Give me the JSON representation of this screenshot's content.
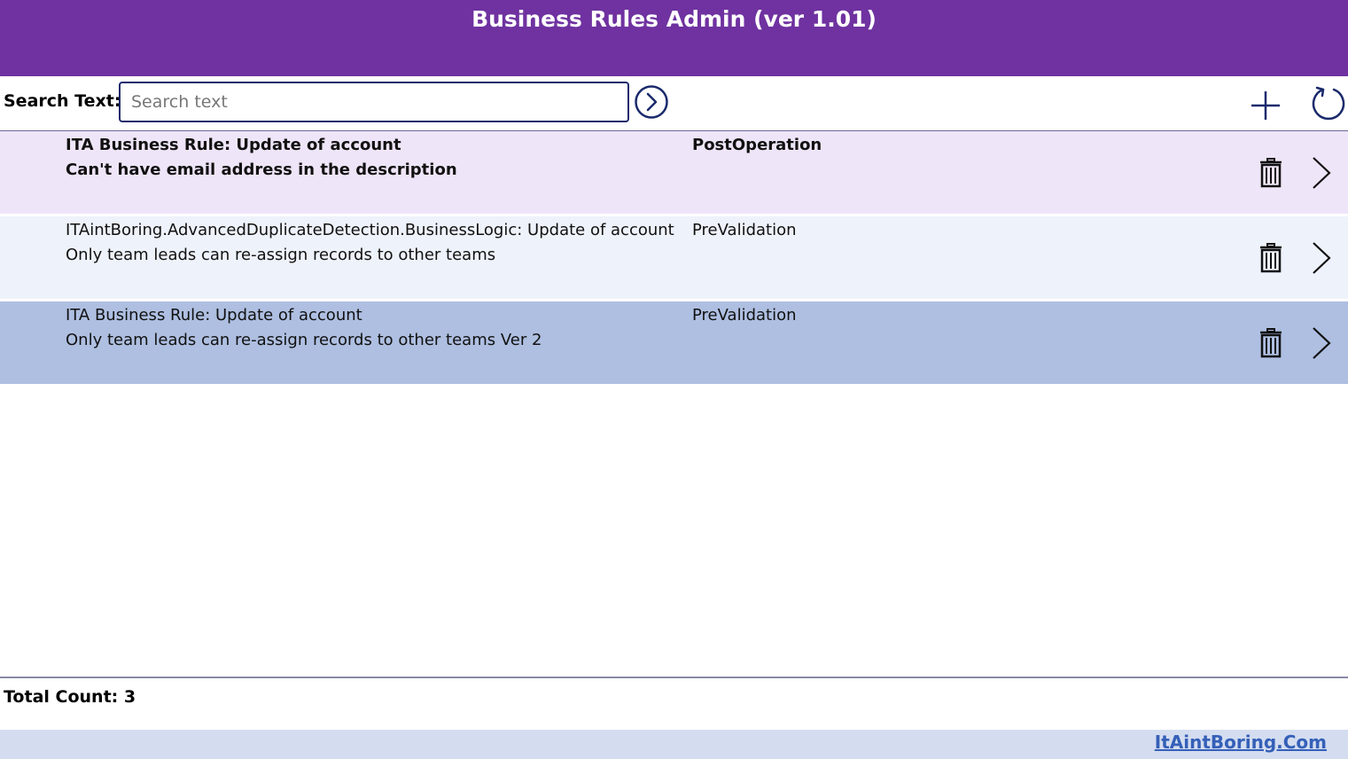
{
  "header": {
    "title": "Business Rules Admin (ver 1.01)",
    "color": "#6f32a0"
  },
  "search": {
    "label": "Search Text:",
    "placeholder": "Search text",
    "value": ""
  },
  "toolbar": {
    "go_icon": "arrow-circle-right-icon",
    "add_icon": "plus-icon",
    "refresh_icon": "refresh-icon"
  },
  "rules": [
    {
      "name": "ITA Business Rule: Update of account",
      "description": "Can't have email address in the description",
      "stage": "PostOperation",
      "background": "#efe5f8",
      "selected": true
    },
    {
      "name": "ITAintBoring.AdvancedDuplicateDetection.BusinessLogic: Update of account",
      "description": "Only team leads can re-assign records to other teams",
      "stage": "PreValidation",
      "background": "#eef2fa",
      "selected": false
    },
    {
      "name": "ITA Business Rule: Update of account",
      "description": "Only team leads can re-assign records to other teams Ver 2",
      "stage": "PreValidation",
      "background": "#aebfe1",
      "selected": false
    }
  ],
  "footer": {
    "total_count": "Total Count: 3",
    "link_text": "ItAintBoring.Com"
  }
}
